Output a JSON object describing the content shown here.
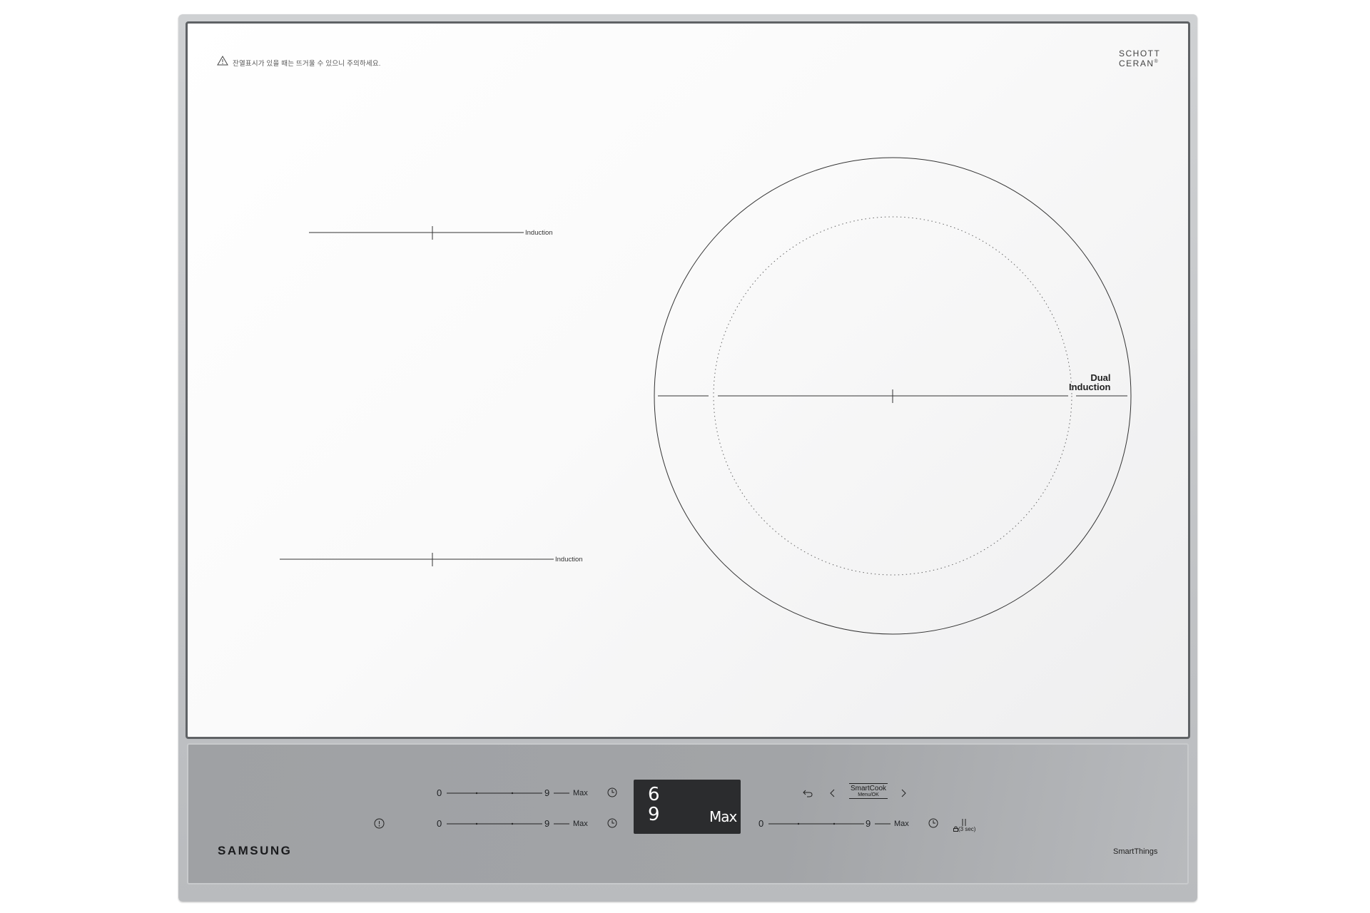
{
  "warning": {
    "icon": "warning-triangle-icon",
    "text": "잔열표시가 있을 때는 뜨거울 수 있으니 주의하세요."
  },
  "glass_brand": {
    "line1": "SCHOTT",
    "line2": "CERAN",
    "mark": "®"
  },
  "zones": {
    "top_left": "Induction",
    "bottom_left": "Induction",
    "right": {
      "line1": "Dual",
      "line2": "Induction"
    }
  },
  "controls": {
    "row1": {
      "min": "0",
      "max_level": "9",
      "max_label": "Max",
      "timer_icon": "clock-icon"
    },
    "row2": {
      "min": "0",
      "max_level": "9",
      "max_label": "Max",
      "timer_icon": "clock-icon"
    },
    "row3": {
      "min": "0",
      "max_level": "9",
      "max_label": "Max",
      "timer_icon": "clock-icon"
    },
    "info_icon": "info-icon",
    "back_icon": "back-arrow-icon",
    "left_icon": "chevron-left-icon",
    "right_icon": "chevron-right-icon",
    "smartcook": {
      "line1": "SmartCook",
      "line2": "Menu/OK"
    },
    "pause_icon": "pause-icon",
    "lock": {
      "icon": "lock-icon",
      "text": "(3 sec)"
    }
  },
  "display": {
    "line1": "6",
    "line2": "9",
    "right": "Max"
  },
  "brand": "SAMSUNG",
  "smartthings": "SmartThings",
  "colors": {
    "glass": "#ffffff",
    "panel": "#a1a3a6",
    "display": "#2b2c2e",
    "trim": "#5f6265"
  }
}
